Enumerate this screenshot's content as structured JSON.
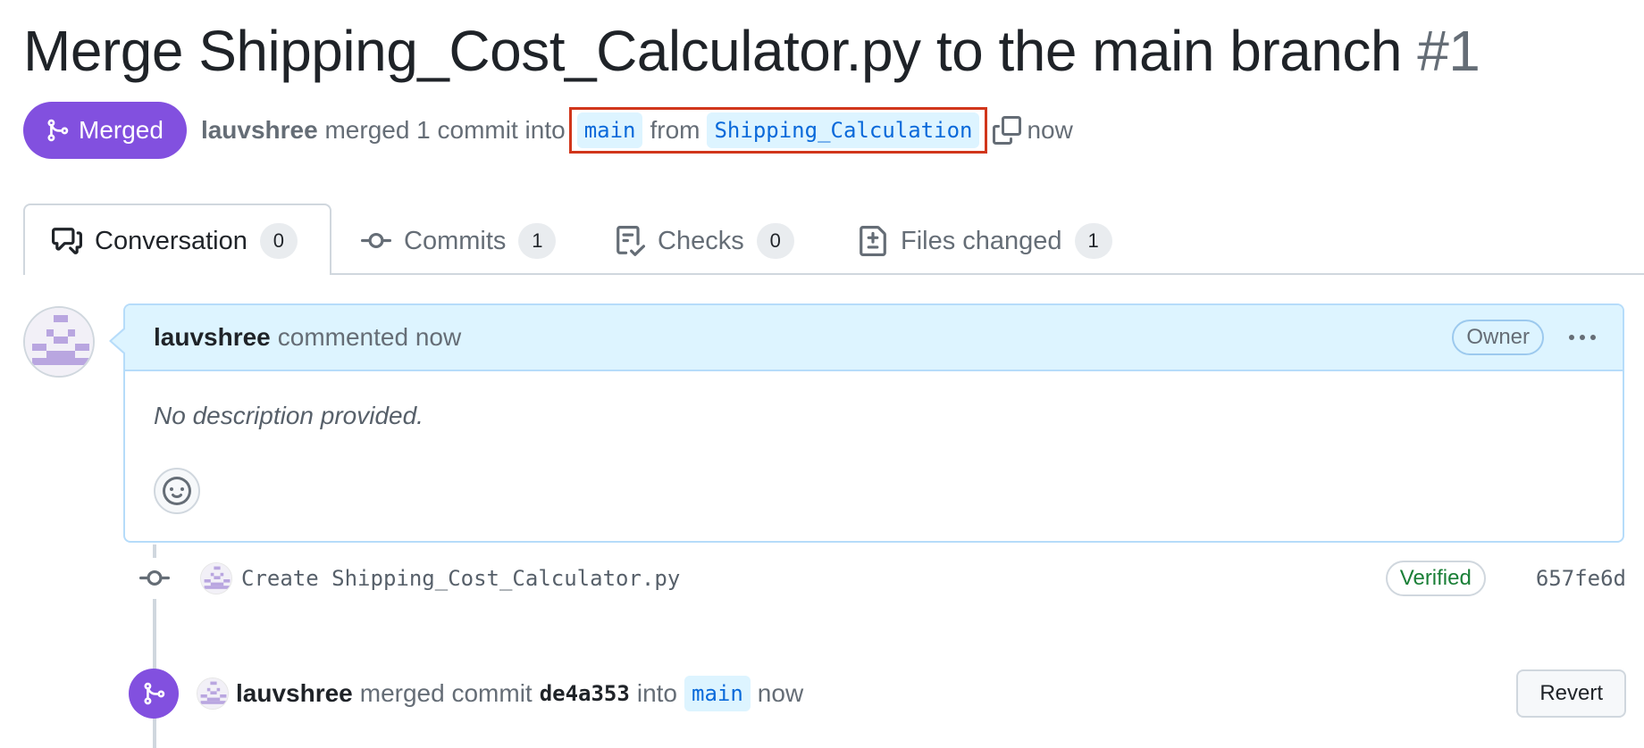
{
  "pr": {
    "title": "Merge Shipping_Cost_Calculator.py to the main branch",
    "number": "#1",
    "status": "Merged",
    "author": "lauvshree",
    "action": "merged 1 commit into",
    "base_branch": "main",
    "from_word": "from",
    "head_branch": "Shipping_Calculation",
    "time": "now"
  },
  "tabs": [
    {
      "label": "Conversation",
      "count": "0"
    },
    {
      "label": "Commits",
      "count": "1"
    },
    {
      "label": "Checks",
      "count": "0"
    },
    {
      "label": "Files changed",
      "count": "1"
    }
  ],
  "comment": {
    "author": "lauvshree",
    "action": "commented now",
    "role": "Owner",
    "body": "No description provided."
  },
  "commit": {
    "message": "Create Shipping_Cost_Calculator.py",
    "badge": "Verified",
    "sha": "657fe6d"
  },
  "merge_event": {
    "author": "lauvshree",
    "action": "merged commit",
    "sha": "de4a353",
    "into_word": "into",
    "branch": "main",
    "time": "now",
    "revert_label": "Revert"
  },
  "colors": {
    "merged_purple": "#8250df",
    "highlight_red": "#d1361b",
    "comment_header_bg": "#ddf4ff",
    "verified_green": "#1a7f37"
  }
}
